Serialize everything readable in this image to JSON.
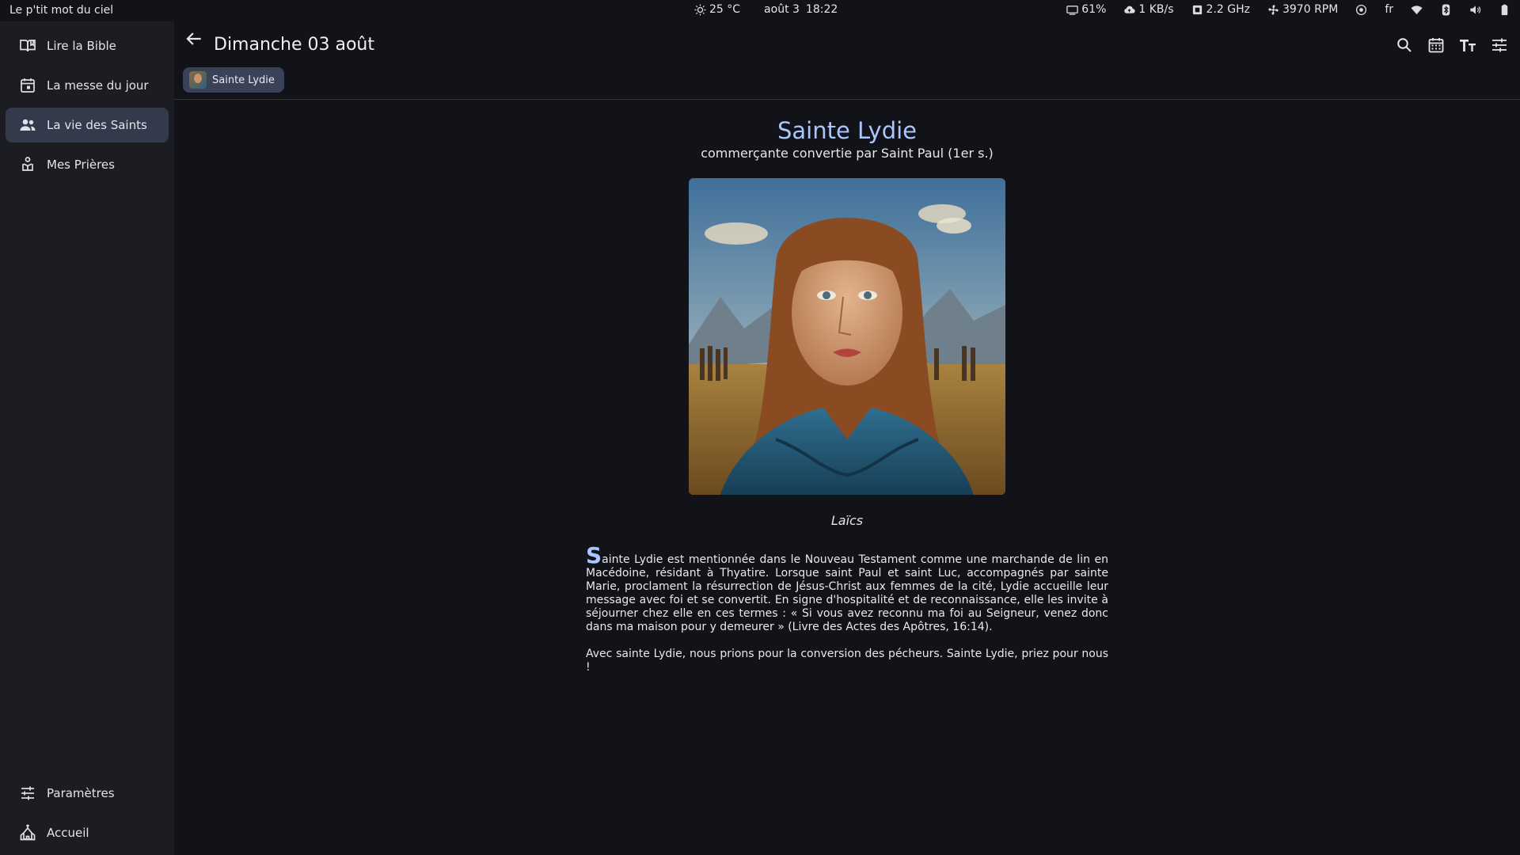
{
  "topbar": {
    "app_title": "Le p'tit mot du ciel",
    "weather": "25 °C",
    "date": "août 3",
    "time": "18:22",
    "battery_saver": "61%",
    "network": "1 KB/s",
    "cpu": "2.2 GHz",
    "fan": "3970 RPM",
    "lang": "fr"
  },
  "sidebar": {
    "items": [
      {
        "label": "Lire la Bible",
        "icon": "book-open-icon"
      },
      {
        "label": "La messe du jour",
        "icon": "calendar-icon"
      },
      {
        "label": "La vie des Saints",
        "icon": "people-icon",
        "active": true
      },
      {
        "label": "Mes Prières",
        "icon": "prayer-icon"
      }
    ],
    "bottom": [
      {
        "label": "Paramètres",
        "icon": "sliders-icon"
      },
      {
        "label": "Accueil",
        "icon": "church-icon"
      }
    ]
  },
  "header": {
    "title": "Dimanche 03 août",
    "chip": "Sainte Lydie"
  },
  "saint": {
    "name": "Sainte Lydie",
    "subtitle": "commerçante convertie par Saint Paul (1er s.)",
    "category": "Laïcs",
    "dropcap": "S",
    "paragraph1": "ainte Lydie est mentionnée dans le Nouveau Testament comme une marchande de lin en Macédoine, résidant à Thyatire. Lorsque saint Paul et saint Luc, accompagnés par sainte Marie, proclament la résurrection de Jésus-Christ aux femmes de la cité, Lydie accueille leur message avec foi et se convertit. En signe d'hospitalité et de reconnaissance, elle les invite à séjourner chez elle en ces termes : « Si vous avez reconnu ma foi au Seigneur, venez donc dans ma maison pour y demeurer » (Livre des Actes des Apôtres, 16:14).",
    "paragraph2": "Avec sainte Lydie, nous prions pour la conversion des pécheurs. Sainte Lydie, priez pour nous !"
  },
  "colors": {
    "accent": "#a9c6ff",
    "background": "#121318",
    "sidebar": "#1b1d23",
    "active_item": "#333a4c"
  }
}
